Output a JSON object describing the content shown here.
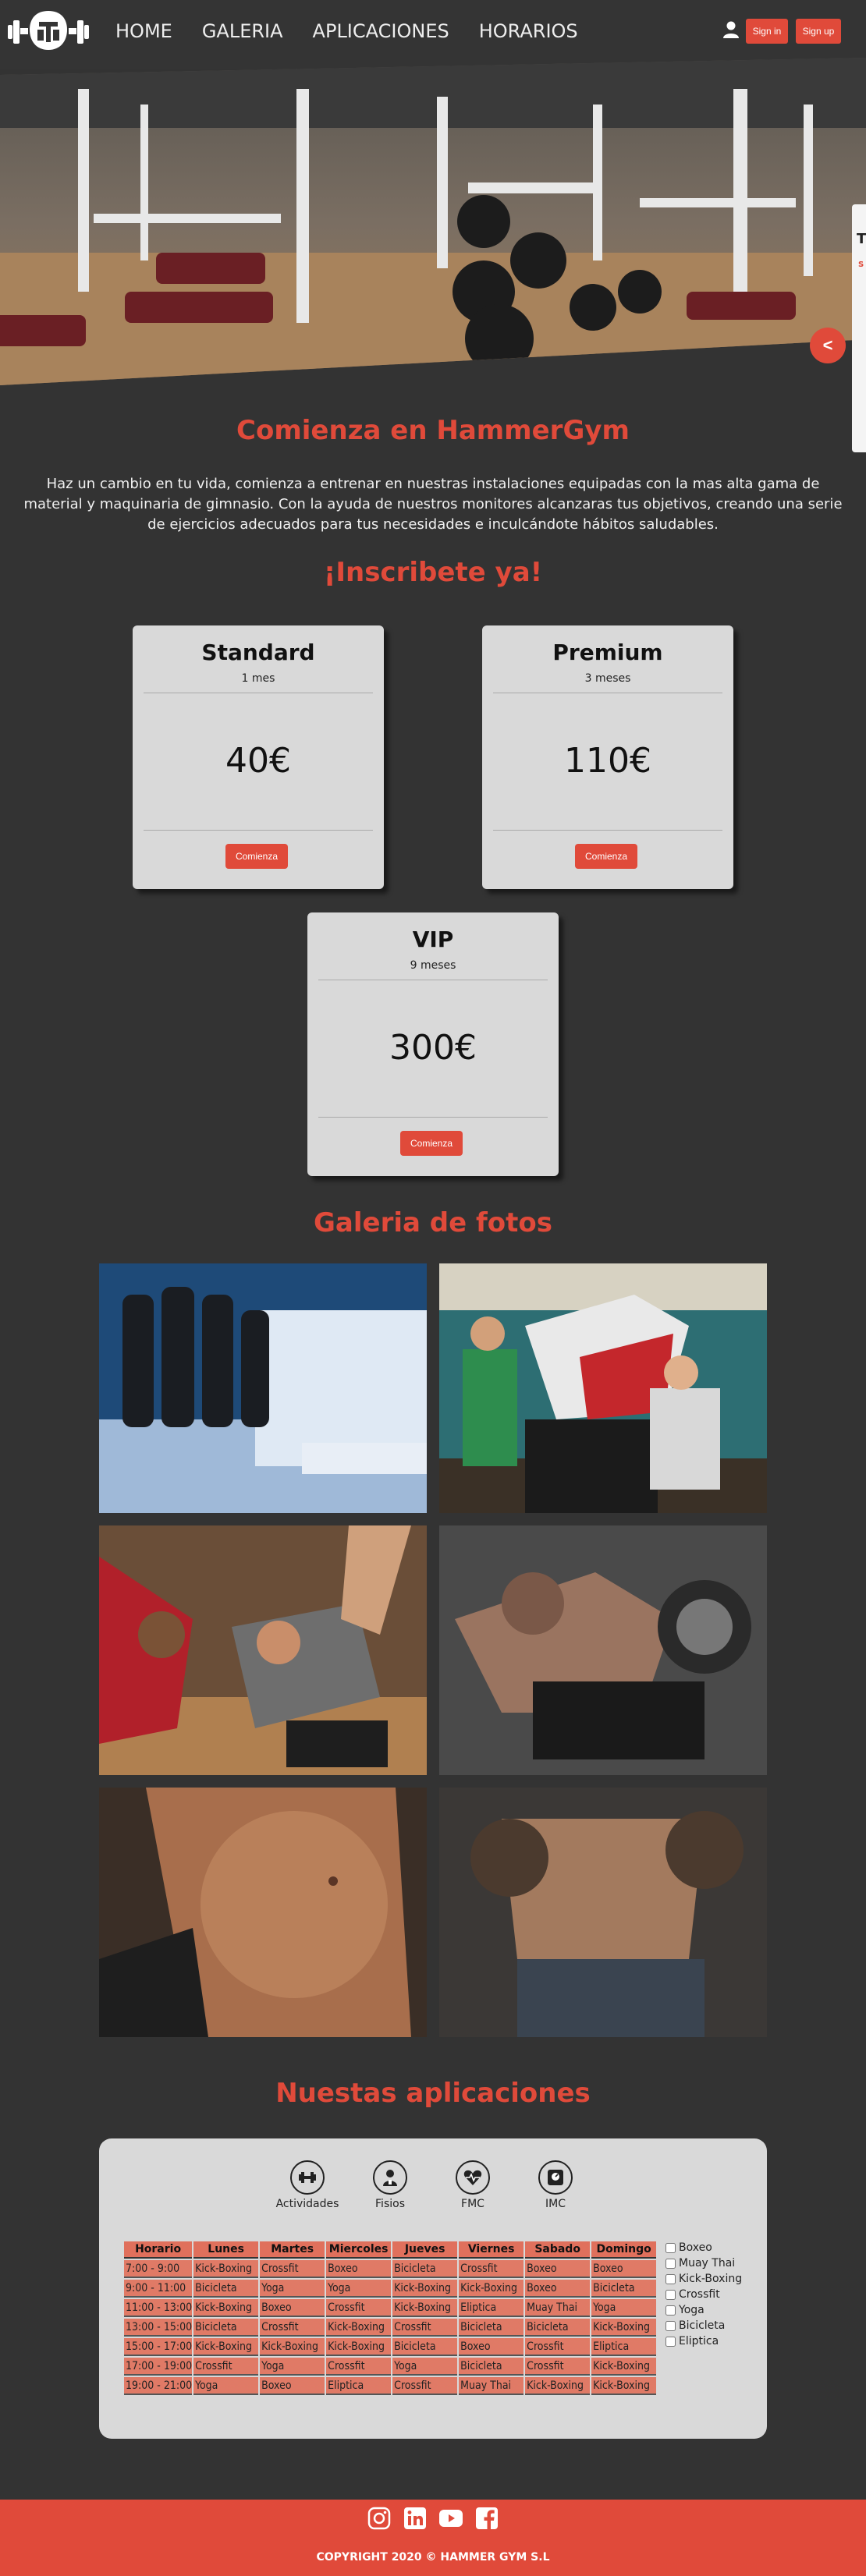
{
  "header": {
    "nav": [
      "HOME",
      "GALERIA",
      "APLICACIONES",
      "HORARIOS"
    ],
    "sign_in": "Sign in",
    "sign_up": "Sign up"
  },
  "hero": {
    "side_tab_text": "T",
    "side_tab_sub": "S",
    "share_icon": "<"
  },
  "intro": {
    "title": "Comienza en HammerGym",
    "text": "Haz un cambio en tu vida, comienza a entrenar en nuestras instalaciones equipadas con la mas alta gama de material y maquinaria de gimnasio. Con la ayuda de nuestros monitores alcanzaras tus objetivos, creando una serie de ejercicios adecuados para tus necesidades e inculcándote hábitos saludables."
  },
  "plans": {
    "title": "¡Inscribete ya!",
    "items": [
      {
        "name": "Standard",
        "duration": "1 mes",
        "price": "40€",
        "button": "Comienza"
      },
      {
        "name": "Premium",
        "duration": "3 meses",
        "price": "110€",
        "button": "Comienza"
      },
      {
        "name": "VIP",
        "duration": "9 meses",
        "price": "300€",
        "button": "Comienza"
      }
    ]
  },
  "gallery": {
    "title": "Galeria de fotos"
  },
  "apps": {
    "title": "Nuestas aplicaciones",
    "items": [
      {
        "label": "Actividades",
        "icon": "dumbbell-icon"
      },
      {
        "label": "Fisios",
        "icon": "physio-icon"
      },
      {
        "label": "FMC",
        "icon": "heart-rate-icon"
      },
      {
        "label": "IMC",
        "icon": "scale-icon"
      }
    ]
  },
  "schedule": {
    "headers": [
      "Horario",
      "Lunes",
      "Martes",
      "Miercoles",
      "Jueves",
      "Viernes",
      "Sabado",
      "Domingo"
    ],
    "rows": [
      [
        "7:00 - 9:00",
        "Kick-Boxing",
        "Crossfit",
        "Boxeo",
        "Bicicleta",
        "Crossfit",
        "Boxeo",
        "Boxeo"
      ],
      [
        "9:00 - 11:00",
        "Bicicleta",
        "Yoga",
        "Yoga",
        "Kick-Boxing",
        "Kick-Boxing",
        "Boxeo",
        "Bicicleta"
      ],
      [
        "11:00 - 13:00",
        "Kick-Boxing",
        "Boxeo",
        "Crossfit",
        "Kick-Boxing",
        "Eliptica",
        "Muay Thai",
        "Yoga"
      ],
      [
        "13:00 - 15:00",
        "Bicicleta",
        "Crossfit",
        "Kick-Boxing",
        "Crossfit",
        "Bicicleta",
        "Bicicleta",
        "Kick-Boxing"
      ],
      [
        "15:00 - 17:00",
        "Kick-Boxing",
        "Kick-Boxing",
        "Kick-Boxing",
        "Bicicleta",
        "Boxeo",
        "Crossfit",
        "Eliptica"
      ],
      [
        "17:00 - 19:00",
        "Crossfit",
        "Yoga",
        "Crossfit",
        "Yoga",
        "Bicicleta",
        "Crossfit",
        "Kick-Boxing"
      ],
      [
        "19:00 - 21:00",
        "Yoga",
        "Boxeo",
        "Eliptica",
        "Crossfit",
        "Muay Thai",
        "Kick-Boxing",
        "Kick-Boxing"
      ]
    ],
    "filters": [
      "Boxeo",
      "Muay Thai",
      "Kick-Boxing",
      "Crossfit",
      "Yoga",
      "Bicicleta",
      "Eliptica"
    ]
  },
  "footer": {
    "socials": [
      "instagram-icon",
      "linkedin-icon",
      "youtube-icon",
      "facebook-icon"
    ],
    "copyright": "COPYRIGHT 2020 © HAMMER GYM S.L"
  },
  "colors": {
    "accent": "#e04a3a",
    "background": "#333333",
    "card": "#d9d9d9"
  }
}
